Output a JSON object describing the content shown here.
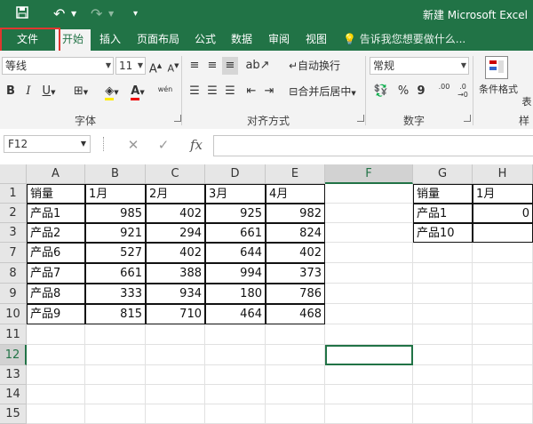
{
  "window": {
    "title": "新建 Microsoft Excel"
  },
  "tabs": [
    "文件",
    "开始",
    "插入",
    "页面布局",
    "公式",
    "数据",
    "审阅",
    "视图"
  ],
  "active_tab": "开始",
  "tell_me": "告诉我您想要做什么...",
  "ribbon": {
    "font_name": "等线",
    "font_size": "11",
    "bold": "B",
    "italic": "I",
    "underline": "U",
    "grow_font": "A",
    "shrink_font": "A",
    "font_color": "A",
    "phonetic": "wén",
    "wrap_text": "自动换行",
    "merge_center": "合并后居中",
    "number_format": "常规",
    "percent": "%",
    "comma": "9",
    "increase_decimal": ".00",
    "conditional_format": "条件格式",
    "table_format": "表",
    "groups": {
      "font": "字体",
      "alignment": "对齐方式",
      "number": "数字",
      "styles": "样"
    }
  },
  "formula_bar": {
    "name_box": "F12",
    "fx": "fx",
    "cancel": "✕",
    "enter": "✓",
    "content": ""
  },
  "sheet": {
    "columns": [
      "A",
      "B",
      "C",
      "D",
      "E",
      "F",
      "G",
      "H"
    ],
    "selected_column": "F",
    "rows": [
      "1",
      "2",
      "3",
      "7",
      "8",
      "9",
      "10",
      "11",
      "12",
      "13",
      "14",
      "15"
    ],
    "selected_row": "12",
    "cells": {
      "r0": [
        "销量",
        "1月",
        "2月",
        "3月",
        "4月",
        "",
        "销量",
        "1月"
      ],
      "r1": [
        "产品1",
        "985",
        "402",
        "925",
        "982",
        "",
        "产品1",
        "0"
      ],
      "r2": [
        "产品2",
        "921",
        "294",
        "661",
        "824",
        "",
        "产品10",
        ""
      ],
      "r3": [
        "产品6",
        "527",
        "402",
        "644",
        "402",
        "",
        "",
        ""
      ],
      "r4": [
        "产品7",
        "661",
        "388",
        "994",
        "373",
        "",
        "",
        ""
      ],
      "r5": [
        "产品8",
        "333",
        "934",
        "180",
        "786",
        "",
        "",
        ""
      ],
      "r6": [
        "产品9",
        "815",
        "710",
        "464",
        "468",
        "",
        "",
        ""
      ]
    }
  },
  "colors": {
    "brand": "#217346",
    "highlight_box": "#e0362f"
  }
}
